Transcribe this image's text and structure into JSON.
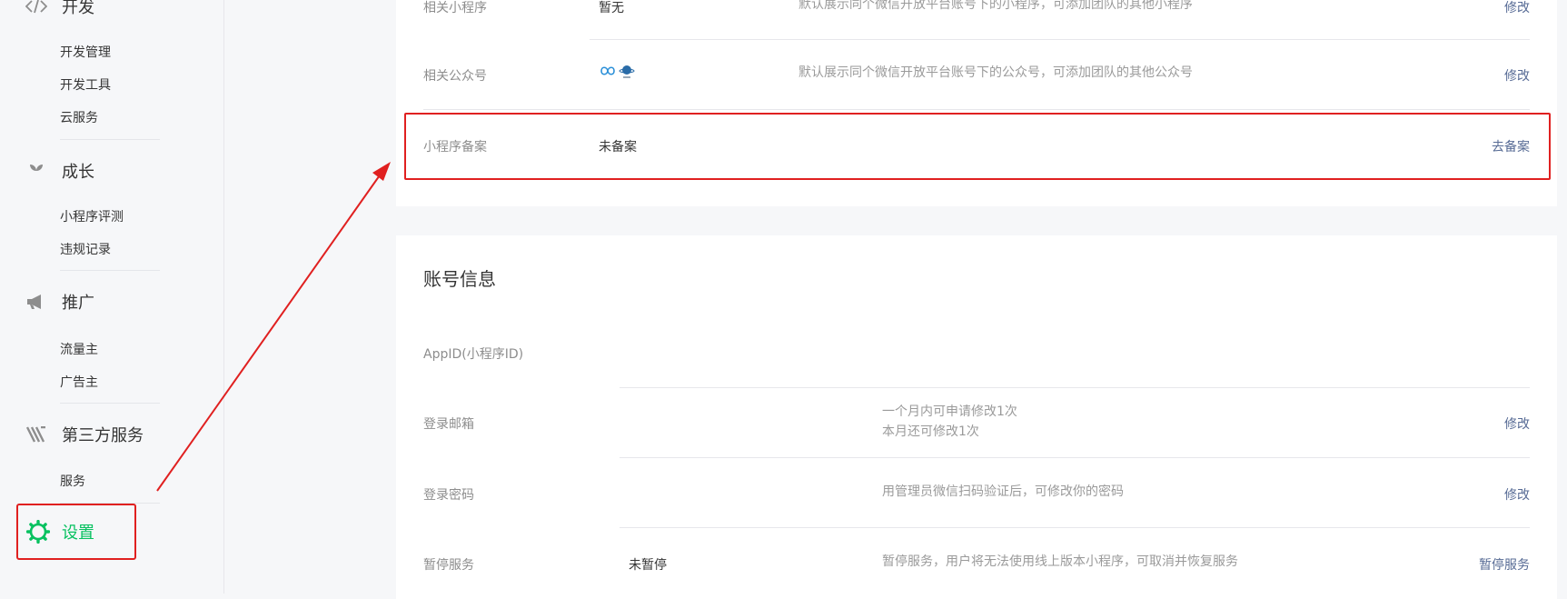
{
  "sidebar": {
    "groups": [
      {
        "title": "开发",
        "icon": "code-icon",
        "items": [
          "开发管理",
          "开发工具",
          "云服务"
        ]
      },
      {
        "title": "成长",
        "icon": "sprout-icon",
        "items": [
          "小程序评测",
          "违规记录"
        ]
      },
      {
        "title": "推广",
        "icon": "megaphone-icon",
        "items": [
          "流量主",
          "广告主"
        ]
      },
      {
        "title": "第三方服务",
        "icon": "third-party-icon",
        "items": [
          "服务"
        ]
      }
    ],
    "settings": {
      "label": "设置",
      "icon": "gear-icon",
      "color": "#07c160"
    }
  },
  "basic_info": {
    "rows": [
      {
        "label": "相关小程序",
        "value": "暂无",
        "desc": "默认展示同个微信开放平台账号下的小程序，可添加团队的其他小程序",
        "action": "修改"
      },
      {
        "label": "相关公众号",
        "value": "",
        "desc": "默认展示同个微信开放平台账号下的公众号，可添加团队的其他公众号",
        "action": "修改"
      },
      {
        "label": "小程序备案",
        "value": "未备案",
        "desc": "",
        "action": "去备案"
      }
    ]
  },
  "account_info": {
    "title": "账号信息",
    "rows": [
      {
        "label": "AppID(小程序ID)",
        "value": "",
        "desc": "",
        "action": ""
      },
      {
        "label": "登录邮箱",
        "value": "",
        "desc_lines": [
          "一个月内可申请修改1次",
          "本月还可修改1次"
        ],
        "action": "修改"
      },
      {
        "label": "登录密码",
        "value": "",
        "desc": "用管理员微信扫码验证后，可修改你的密码",
        "action": "修改"
      },
      {
        "label": "暂停服务",
        "value": "未暂停",
        "desc": "暂停服务，用户将无法使用线上版本小程序，可取消并恢复服务",
        "action": "暂停服务"
      }
    ]
  },
  "colors": {
    "accent": "#07c160",
    "link": "#576b95",
    "annotation": "#e02020"
  }
}
